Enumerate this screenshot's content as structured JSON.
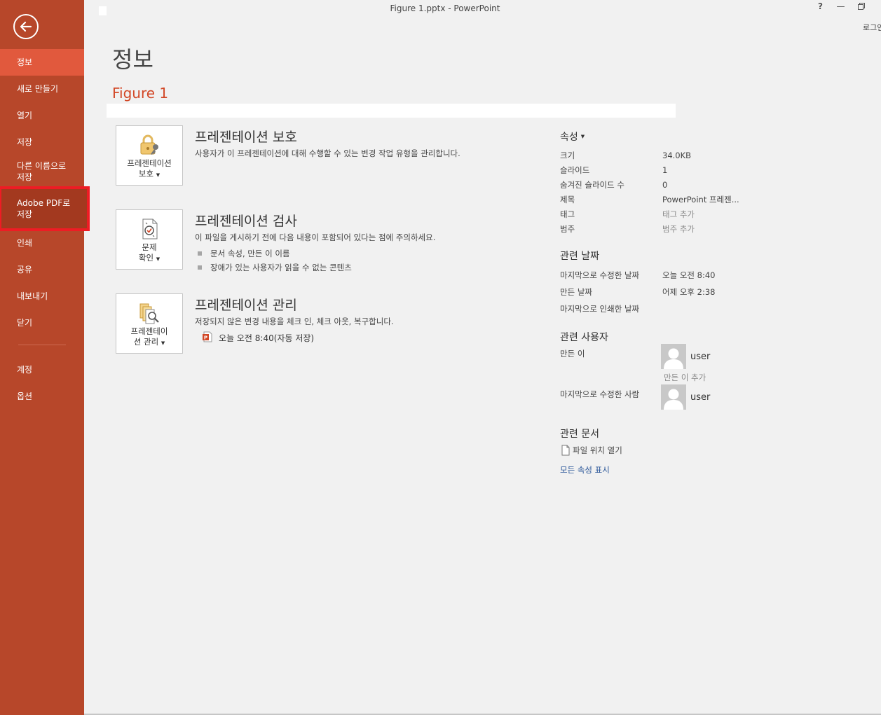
{
  "window": {
    "title": "Figure 1.pptx - PowerPoint",
    "help": "?",
    "minimize": "—",
    "restore": "🗗",
    "signin": "로그인"
  },
  "colors": {
    "sidebar": "#b7472a",
    "active": "#e1593d",
    "accent": "#d24726",
    "highlight_border": "#ee1c24",
    "link": "#2a5699"
  },
  "sidebar": {
    "items": [
      {
        "label": "정보"
      },
      {
        "label": "새로 만들기"
      },
      {
        "label": "열기"
      },
      {
        "label": "저장"
      },
      {
        "label": "다른 이름으로 저장"
      },
      {
        "label": "Adobe PDF로 저장"
      },
      {
        "label": "인쇄"
      },
      {
        "label": "공유"
      },
      {
        "label": "내보내기"
      },
      {
        "label": "닫기"
      }
    ],
    "bottom_items": [
      {
        "label": "계정"
      },
      {
        "label": "옵션"
      }
    ]
  },
  "main": {
    "page_title": "정보",
    "doc_title": "Figure 1",
    "sections": [
      {
        "button_label_1": "프레젠테이션",
        "button_label_2": "보호",
        "heading": "프레젠테이션 보호",
        "desc": "사용자가 이 프레젠테이션에 대해 수행할 수 있는 변경 작업 유형을 관리합니다."
      },
      {
        "button_label_1": "문제",
        "button_label_2": "확인",
        "heading": "프레젠테이션 검사",
        "desc": "이 파일을 게시하기 전에 다음 내용이 포함되어 있다는 점에 주의하세요.",
        "bullets": [
          "문서 속성, 만든 이 이름",
          "장애가 있는 사용자가 읽을 수 없는 콘텐츠"
        ]
      },
      {
        "button_label_1": "프레젠테이",
        "button_label_2": "션 관리",
        "heading": "프레젠테이션 관리",
        "desc": "저장되지 않은 변경 내용을 체크 인, 체크 아웃, 복구합니다.",
        "autosave": "오늘 오전 8:40(자동 저장)"
      }
    ]
  },
  "properties": {
    "heading": "속성",
    "rows": [
      {
        "label": "크기",
        "value": "34.0KB"
      },
      {
        "label": "슬라이드",
        "value": "1"
      },
      {
        "label": "숨겨진 슬라이드 수",
        "value": "0"
      },
      {
        "label": "제목",
        "value": "PowerPoint 프레젠..."
      },
      {
        "label": "태그",
        "value": "태그 추가"
      },
      {
        "label": "범주",
        "value": "범주 추가"
      }
    ],
    "dates_heading": "관련 날짜",
    "dates": [
      {
        "label": "마지막으로 수정한 날짜",
        "value": "오늘 오전 8:40"
      },
      {
        "label": "만든 날짜",
        "value": "어제 오후 2:38"
      },
      {
        "label": "마지막으로 인쇄한 날짜",
        "value": ""
      }
    ],
    "people_heading": "관련 사용자",
    "author_label": "만든 이",
    "author_name": "user",
    "add_author": "만든 이 추가",
    "modified_by_label": "마지막으로 수정한 사람",
    "modified_by_name": "user",
    "docs_heading": "관련 문서",
    "open_location": "파일 위치 열기",
    "show_all": "모든 속성 표시"
  }
}
